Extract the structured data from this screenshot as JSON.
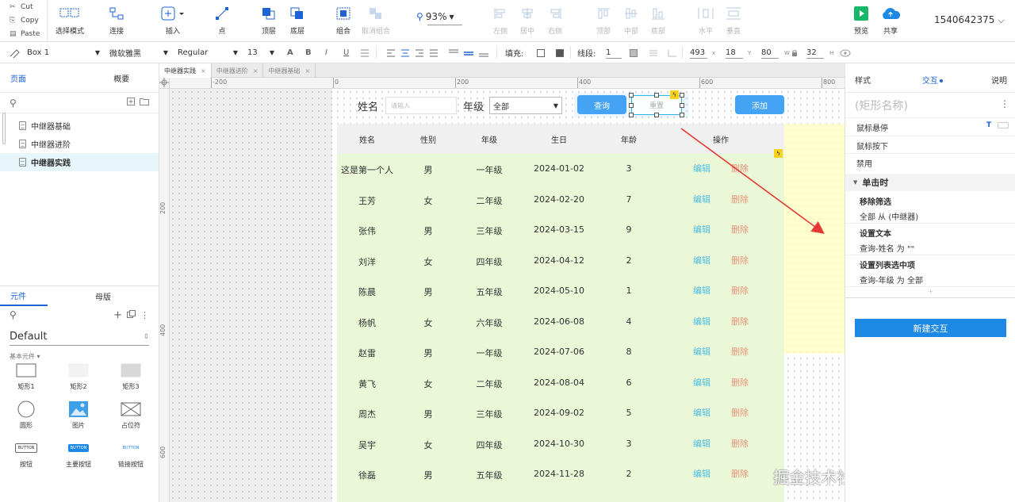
{
  "clipboard": [
    {
      "icon": "✂",
      "label": "Cut"
    },
    {
      "icon": "⎘",
      "label": "Copy"
    },
    {
      "icon": "▤",
      "label": "Paste"
    }
  ],
  "toolbar": {
    "select_mode": "选择模式",
    "connect": "连接",
    "insert": "插入",
    "point": "点",
    "top_layer": "顶层",
    "bottom_layer": "底层",
    "group": "组合",
    "ungroup": "取消组合",
    "zoom": "93%",
    "align_left": "左侧",
    "align_center": "居中",
    "align_right": "右侧",
    "align_top": "顶部",
    "align_middle": "中部",
    "align_bottom": "底部",
    "distribute_h": "水平",
    "distribute_v": "垂直",
    "preview": "预览",
    "share": "共享",
    "user": "1540642375"
  },
  "format": {
    "style_name": "Box 1",
    "font_family": "微软雅黑",
    "font_weight": "Regular",
    "font_size": "13",
    "bold": "B",
    "italic": "I",
    "underline": "U",
    "fill_label": "填充:",
    "line_label": "线段:",
    "line_width": "1",
    "x": "493",
    "x_label": "x",
    "y": "18",
    "y_label": "Y",
    "w": "80",
    "w_label": "W",
    "h": "32",
    "h_label": "H"
  },
  "pages_panel": {
    "tab_pages": "页面",
    "tab_outline": "概要",
    "pages": [
      "中继器基础",
      "中继器进阶",
      "中继器实践"
    ],
    "active_index": 2
  },
  "library_panel": {
    "tab_widgets": "元件",
    "tab_masters": "母版",
    "library": "Default",
    "category": "基本元件 ▾",
    "widgets": [
      {
        "name": "矩形1",
        "shape": "rect"
      },
      {
        "name": "矩形2",
        "shape": "rect2"
      },
      {
        "name": "矩形3",
        "shape": "rect3"
      },
      {
        "name": "圆形",
        "shape": "circle"
      },
      {
        "name": "图片",
        "shape": "image"
      },
      {
        "name": "占位符",
        "shape": "placeholder"
      },
      {
        "name": "按钮",
        "shape": "btn1"
      },
      {
        "name": "主要按钮",
        "shape": "btn2"
      },
      {
        "name": "链接按钮",
        "shape": "btn3"
      }
    ],
    "button_text": "BUTTON"
  },
  "doc_tabs": [
    "中继器实践",
    "中继器进阶",
    "中继器基础"
  ],
  "ruler": {
    "h": [
      "-200",
      "0",
      "200",
      "400",
      "600",
      "800"
    ],
    "v": [
      "200",
      "400",
      "600"
    ]
  },
  "canvas": {
    "name_label": "姓名",
    "name_placeholder": "请输入",
    "grade_label": "年级",
    "grade_value": "全部",
    "query_button": "查询",
    "reset_button": "重置",
    "add_button": "添加",
    "headers": [
      "姓名",
      "性别",
      "年级",
      "生日",
      "年龄",
      "操作"
    ],
    "edit": "编辑",
    "delete": "删除",
    "rows": [
      [
        "这是第一个人",
        "男",
        "一年级",
        "2024-01-02",
        "3"
      ],
      [
        "王芳",
        "女",
        "二年级",
        "2024-02-20",
        "7"
      ],
      [
        "张伟",
        "男",
        "三年级",
        "2024-03-15",
        "9"
      ],
      [
        "刘洋",
        "女",
        "四年级",
        "2024-04-12",
        "2"
      ],
      [
        "陈晨",
        "男",
        "五年级",
        "2024-05-10",
        "1"
      ],
      [
        "杨帆",
        "女",
        "六年级",
        "2024-06-08",
        "4"
      ],
      [
        "赵雷",
        "男",
        "一年级",
        "2024-07-06",
        "8"
      ],
      [
        "黄飞",
        "女",
        "二年级",
        "2024-08-04",
        "6"
      ],
      [
        "周杰",
        "男",
        "三年级",
        "2024-09-02",
        "5"
      ],
      [
        "吴宇",
        "女",
        "四年级",
        "2024-10-30",
        "3"
      ],
      [
        "徐磊",
        "男",
        "五年级",
        "2024-11-28",
        "2"
      ]
    ]
  },
  "right_panel": {
    "tab_style": "样式",
    "tab_interaction": "交互",
    "tab_notes": "说明",
    "shape_name_placeholder": "(矩形名称)",
    "states": [
      "鼠标悬停",
      "鼠标按下",
      "禁用"
    ],
    "event": "单击时",
    "actions": [
      {
        "title": "移除筛选",
        "desc": "全部 从 (中继器)"
      },
      {
        "title": "设置文本",
        "desc": "查询-姓名 为 \"\""
      },
      {
        "title": "设置列表选中项",
        "desc": "查询-年级 为 全部"
      }
    ],
    "new_interaction": "新建交互"
  },
  "watermark": "掘金技术社区 @ 我码玄黄",
  "colors": {
    "accent": "#1e63d6",
    "primary_btn": "#45a3f5",
    "table_bg": "#eaf8d8",
    "edit": "#4fbde3",
    "delete": "#e8927d"
  }
}
